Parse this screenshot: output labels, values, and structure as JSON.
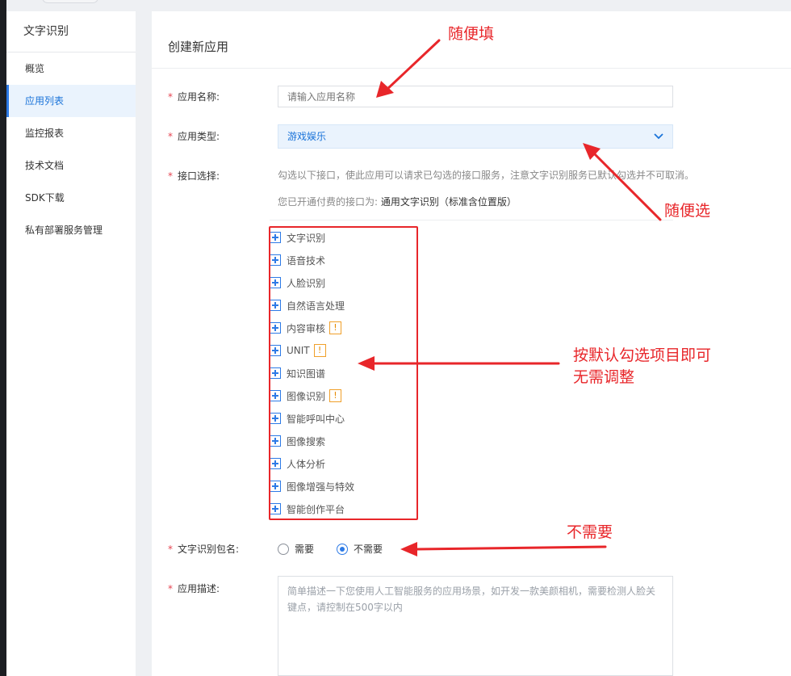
{
  "sidebar": {
    "title": "文字识别",
    "items": [
      {
        "label": "概览"
      },
      {
        "label": "应用列表"
      },
      {
        "label": "监控报表"
      },
      {
        "label": "技术文档"
      },
      {
        "label": "SDK下载"
      },
      {
        "label": "私有部署服务管理"
      }
    ]
  },
  "page": {
    "title": "创建新应用"
  },
  "form": {
    "required_mark": "*",
    "app_name": {
      "label": "应用名称:",
      "placeholder": "请输入应用名称"
    },
    "app_type": {
      "label": "应用类型:",
      "value": "游戏娱乐"
    },
    "api_select": {
      "label": "接口选择:",
      "hint": "勾选以下接口，使此应用可以请求已勾选的接口服务，注意文字识别服务已默认勾选并不可取消。",
      "paid_prefix": "您已开通付费的接口为:",
      "paid_value": "通用文字识别（标准含位置版）",
      "warn_mark": "!",
      "items": [
        {
          "label": "文字识别",
          "warn": false
        },
        {
          "label": "语音技术",
          "warn": false
        },
        {
          "label": "人脸识别",
          "warn": false
        },
        {
          "label": "自然语言处理",
          "warn": false
        },
        {
          "label": "内容审核",
          "warn": true
        },
        {
          "label": "UNIT",
          "warn": true
        },
        {
          "label": "知识图谱",
          "warn": false
        },
        {
          "label": "图像识别",
          "warn": true
        },
        {
          "label": "智能呼叫中心",
          "warn": false
        },
        {
          "label": "图像搜索",
          "warn": false
        },
        {
          "label": "人体分析",
          "warn": false
        },
        {
          "label": "图像增强与特效",
          "warn": false
        },
        {
          "label": "智能创作平台",
          "warn": false
        }
      ]
    },
    "package_name": {
      "label": "文字识别包名:",
      "options": [
        {
          "label": "需要",
          "checked": false
        },
        {
          "label": "不需要",
          "checked": true
        }
      ]
    },
    "app_desc": {
      "label": "应用描述:",
      "placeholder": "简单描述一下您使用人工智能服务的应用场景，如开发一款美颜相机，需要检测人脸关键点，请控制在500字以内"
    }
  },
  "annotations": {
    "name_tip": "随便填",
    "type_tip": "随便选",
    "api_tip_line1": "按默认勾选项目即可",
    "api_tip_line2": "无需调整",
    "package_tip": "不需要",
    "color": "#e8262a"
  },
  "icons": {
    "select_arrow": "chevron-down-icon",
    "api_expand": "plus-square-icon",
    "warning": "exclamation-icon"
  }
}
